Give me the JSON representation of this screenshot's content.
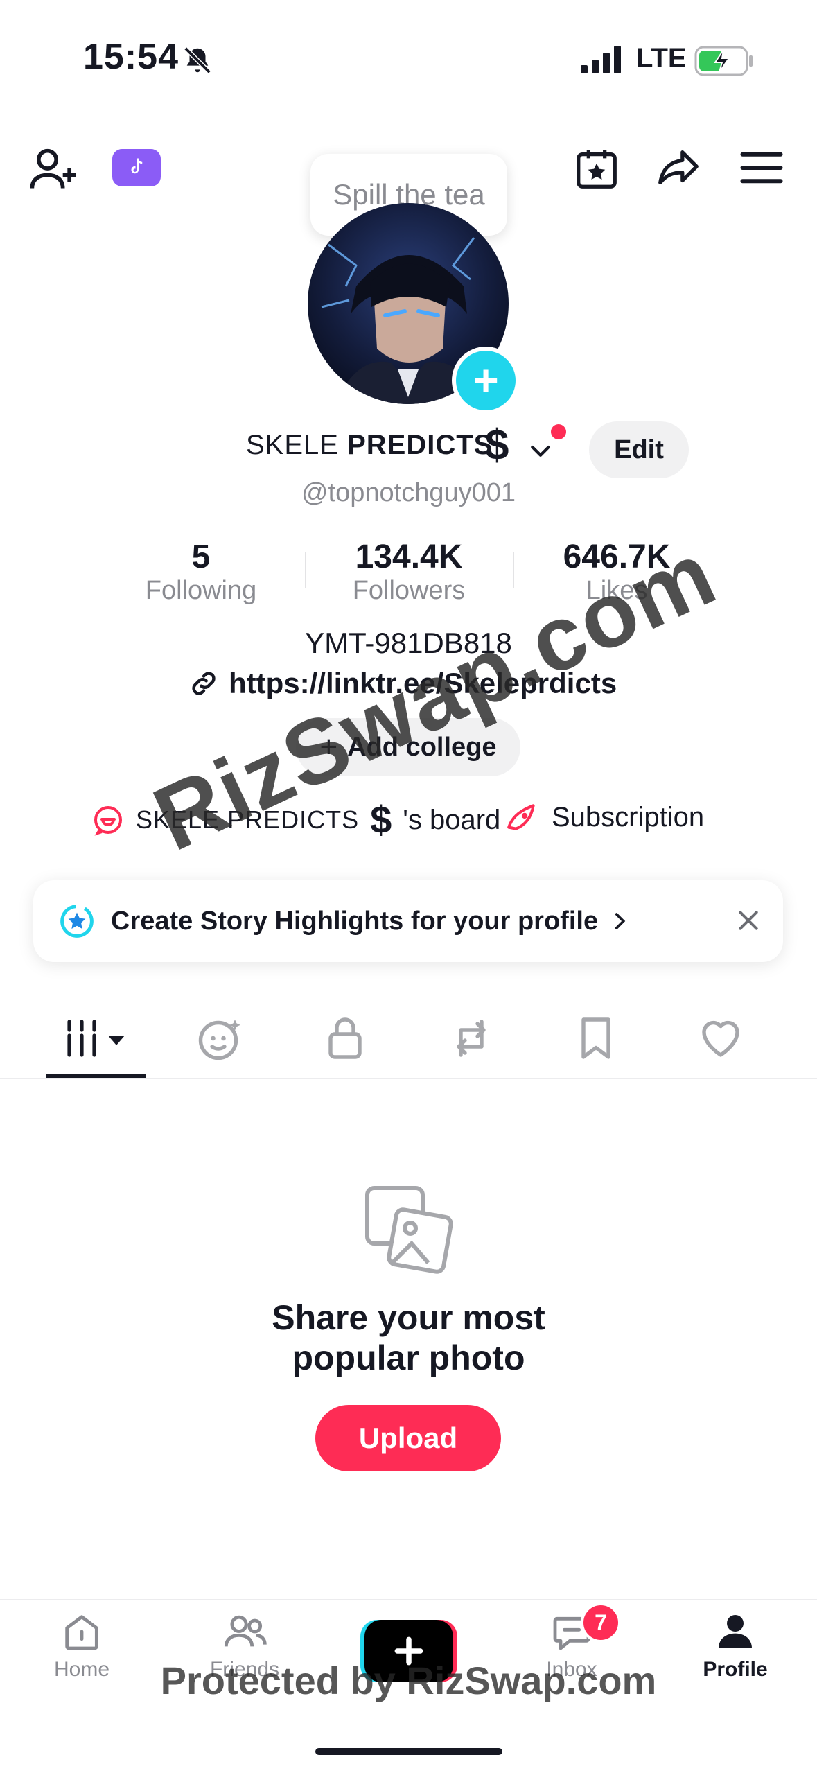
{
  "status_bar": {
    "time": "15:54",
    "network": "LTE"
  },
  "header": {
    "tooltip": "Spill the tea"
  },
  "profile": {
    "name_prefix": "SKELE ",
    "name_bold": "PREDICTS",
    "name_symbol": "$",
    "edit_label": "Edit",
    "handle": "@topnotchguy001",
    "stats": [
      {
        "value": "5",
        "label": "Following"
      },
      {
        "value": "134.4K",
        "label": "Followers"
      },
      {
        "value": "646.7K",
        "label": "Likes"
      }
    ],
    "bio": "YMT-981DB818",
    "link": "https://linktr.ee/Skeleprdicts",
    "add_college": "Add college",
    "board_name": "SKELE PREDICTS",
    "board_symbol": "$",
    "board_suffix": "'s board",
    "subscription": "Subscription"
  },
  "story_banner": {
    "text": "Create Story Highlights for your profile"
  },
  "tabs": [
    "videos-grid",
    "reposts-face",
    "private-lock",
    "repost",
    "favorites",
    "liked"
  ],
  "empty_state": {
    "line1": "Share your most",
    "line2": "popular photo",
    "upload_label": "Upload"
  },
  "bottom_nav": {
    "items": [
      {
        "label": "Home"
      },
      {
        "label": "Friends"
      },
      {
        "label": ""
      },
      {
        "label": "Inbox",
        "badge": "7"
      },
      {
        "label": "Profile"
      }
    ]
  },
  "watermarks": {
    "diagonal": "RizSwap.com",
    "bottom": "Protected by RizSwap.com"
  },
  "colors": {
    "accent": "#fe2c55",
    "cyan": "#20d5ec",
    "purple": "#8b5cf6"
  }
}
